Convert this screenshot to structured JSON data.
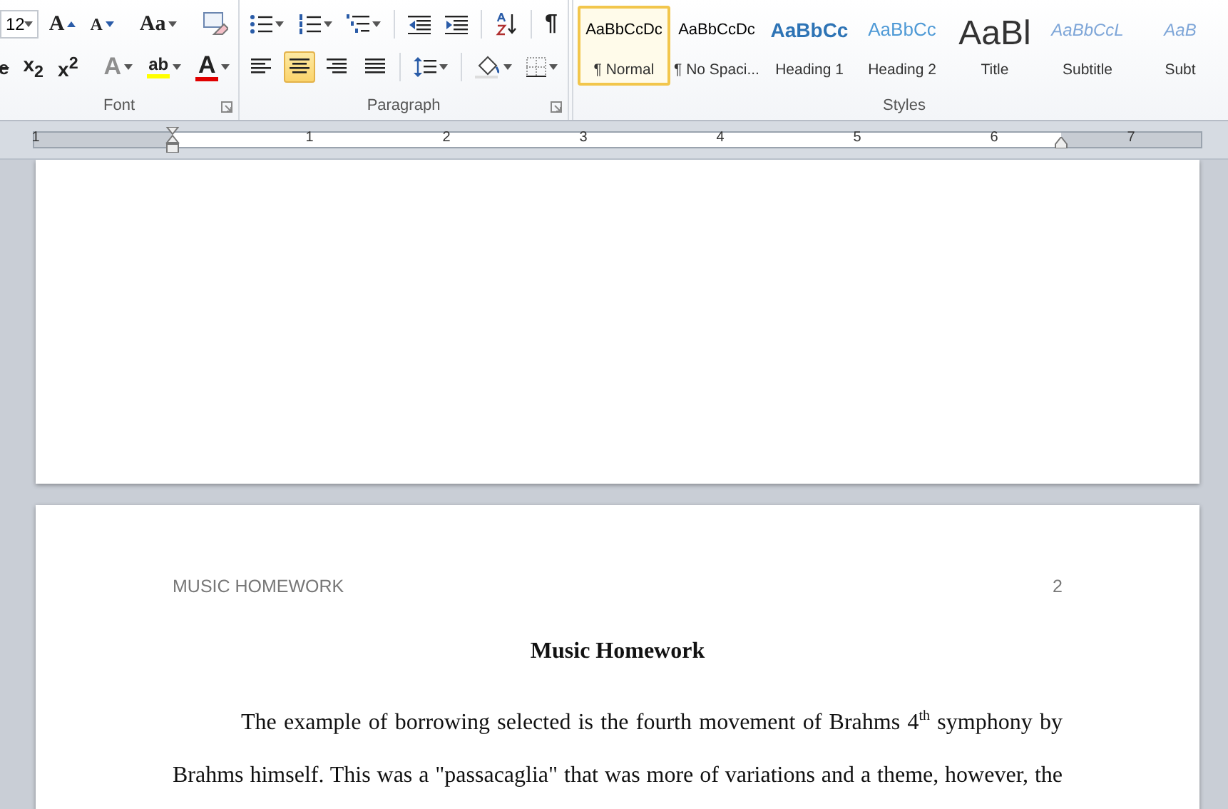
{
  "ribbon": {
    "font_group": {
      "label": "Font",
      "font_size": "12",
      "row1": [
        {
          "kind": "grow",
          "label": "A"
        },
        {
          "kind": "shrink",
          "label": "A"
        },
        {
          "kind": "case",
          "label": "Aa"
        },
        {
          "kind": "clear"
        }
      ],
      "row2": [
        {
          "kind": "strike",
          "label": "e"
        },
        {
          "kind": "sub",
          "label": "x",
          "script": "2"
        },
        {
          "kind": "sup",
          "label": "x",
          "script": "2"
        },
        {
          "kind": "effects",
          "label": "A",
          "disabled": true
        },
        {
          "kind": "highlight",
          "label": "ab",
          "color": "#ffff00"
        },
        {
          "kind": "fontcolor",
          "label": "A",
          "color": "#e00000"
        }
      ]
    },
    "paragraph_group": {
      "label": "Paragraph",
      "row1": [
        {
          "kind": "bullets"
        },
        {
          "kind": "numbering"
        },
        {
          "kind": "multilevel"
        },
        {
          "kind": "outdent"
        },
        {
          "kind": "indent"
        },
        {
          "kind": "sort"
        },
        {
          "kind": "marks",
          "label": "¶"
        }
      ],
      "row2": [
        {
          "kind": "left",
          "selected": false
        },
        {
          "kind": "center",
          "selected": true
        },
        {
          "kind": "right",
          "selected": false
        },
        {
          "kind": "justify",
          "selected": false
        },
        {
          "kind": "spacing"
        },
        {
          "kind": "shading"
        },
        {
          "kind": "borders"
        }
      ]
    },
    "styles_group": {
      "label": "Styles",
      "items": [
        {
          "kind": "normal",
          "preview": "AaBbCcDc",
          "name": "¶ Normal",
          "selected": true
        },
        {
          "kind": "normal",
          "preview": "AaBbCcDc",
          "name": "¶ No Spaci...",
          "selected": false
        },
        {
          "kind": "heading1",
          "preview": "AaBbCc",
          "name": "Heading 1",
          "selected": false
        },
        {
          "kind": "heading2",
          "preview": "AaBbCc",
          "name": "Heading 2",
          "selected": false
        },
        {
          "kind": "title",
          "preview": "AaBl",
          "name": "Title",
          "selected": false
        },
        {
          "kind": "subtitle",
          "preview": "AaBbCcL",
          "name": "Subtitle",
          "selected": false
        },
        {
          "kind": "subtitle",
          "preview": "AaB",
          "name": "Subt",
          "selected": false
        }
      ]
    }
  },
  "ruler": {
    "labels": [
      "1",
      "1",
      "2",
      "3",
      "4",
      "5",
      "6",
      "7"
    ]
  },
  "page": {
    "header": "MUSIC HOMEWORK",
    "page_number": "2",
    "title": "Music Homework",
    "body": "The example of borrowing selected is the fourth movement of Brahms 4$^{th}$ symphony by Brahms himself. This was a \"passacaglia\"  that was more of variations and a theme, however, the"
  }
}
